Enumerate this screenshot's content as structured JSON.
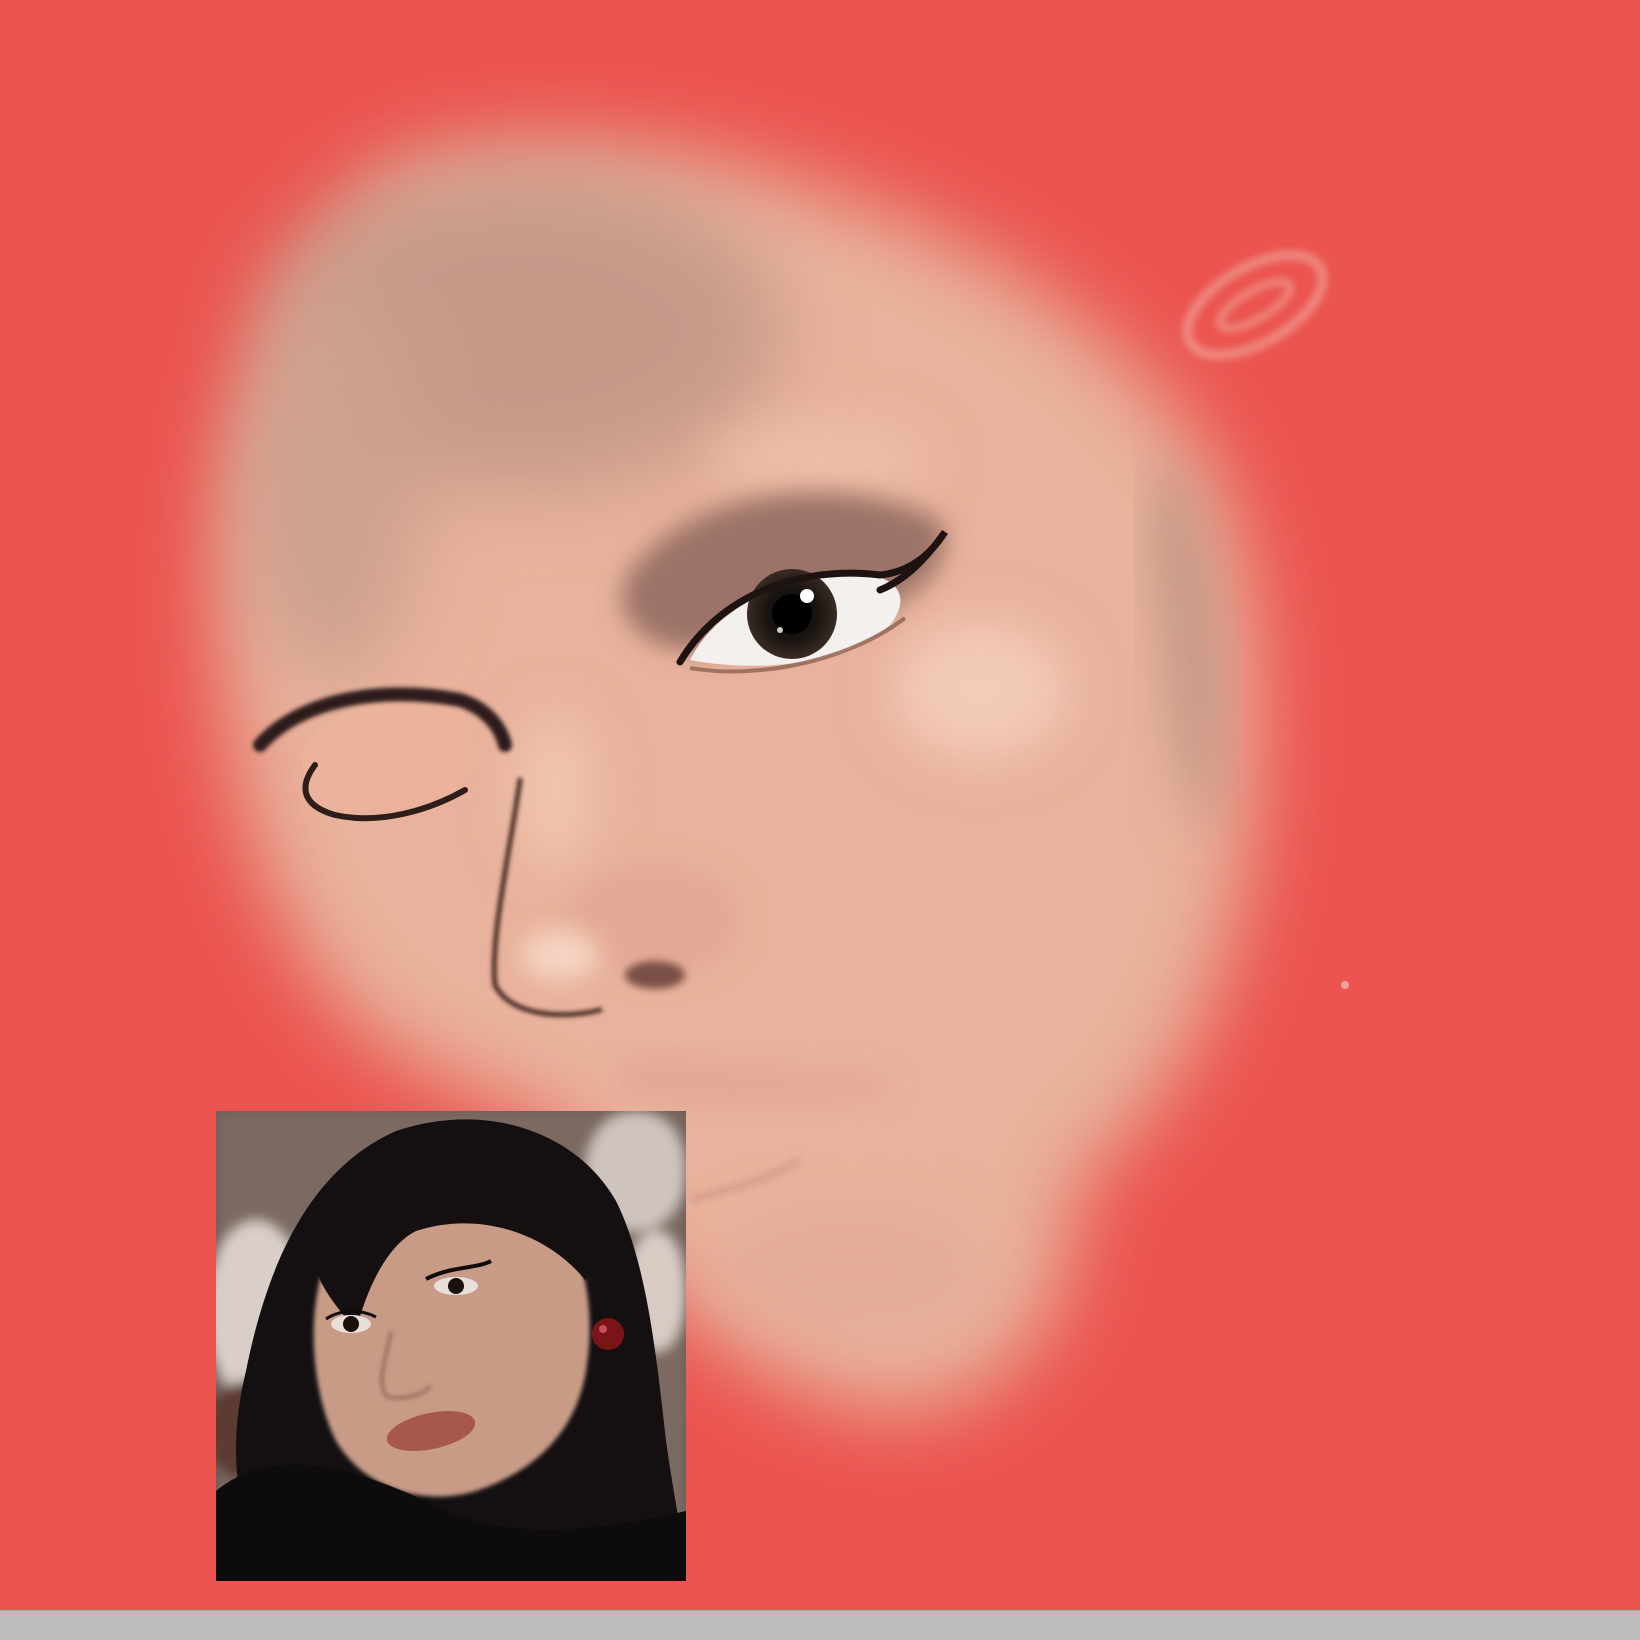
{
  "colors": {
    "canvas_background": "#EB544F",
    "bottom_bar": "#BDBDBD",
    "skin_base": "#E9B7A0",
    "skin_shadow": "#C39684",
    "eyeliner": "#2A1A16",
    "photo_hair": "#141012",
    "photo_skin": "#C79A86",
    "photo_lips": "#A8584A",
    "earring": "#7A1418"
  },
  "canvas": {
    "content_type": "digital-portrait-painting-in-progress",
    "reference_image": "reference-selfie-photo"
  }
}
